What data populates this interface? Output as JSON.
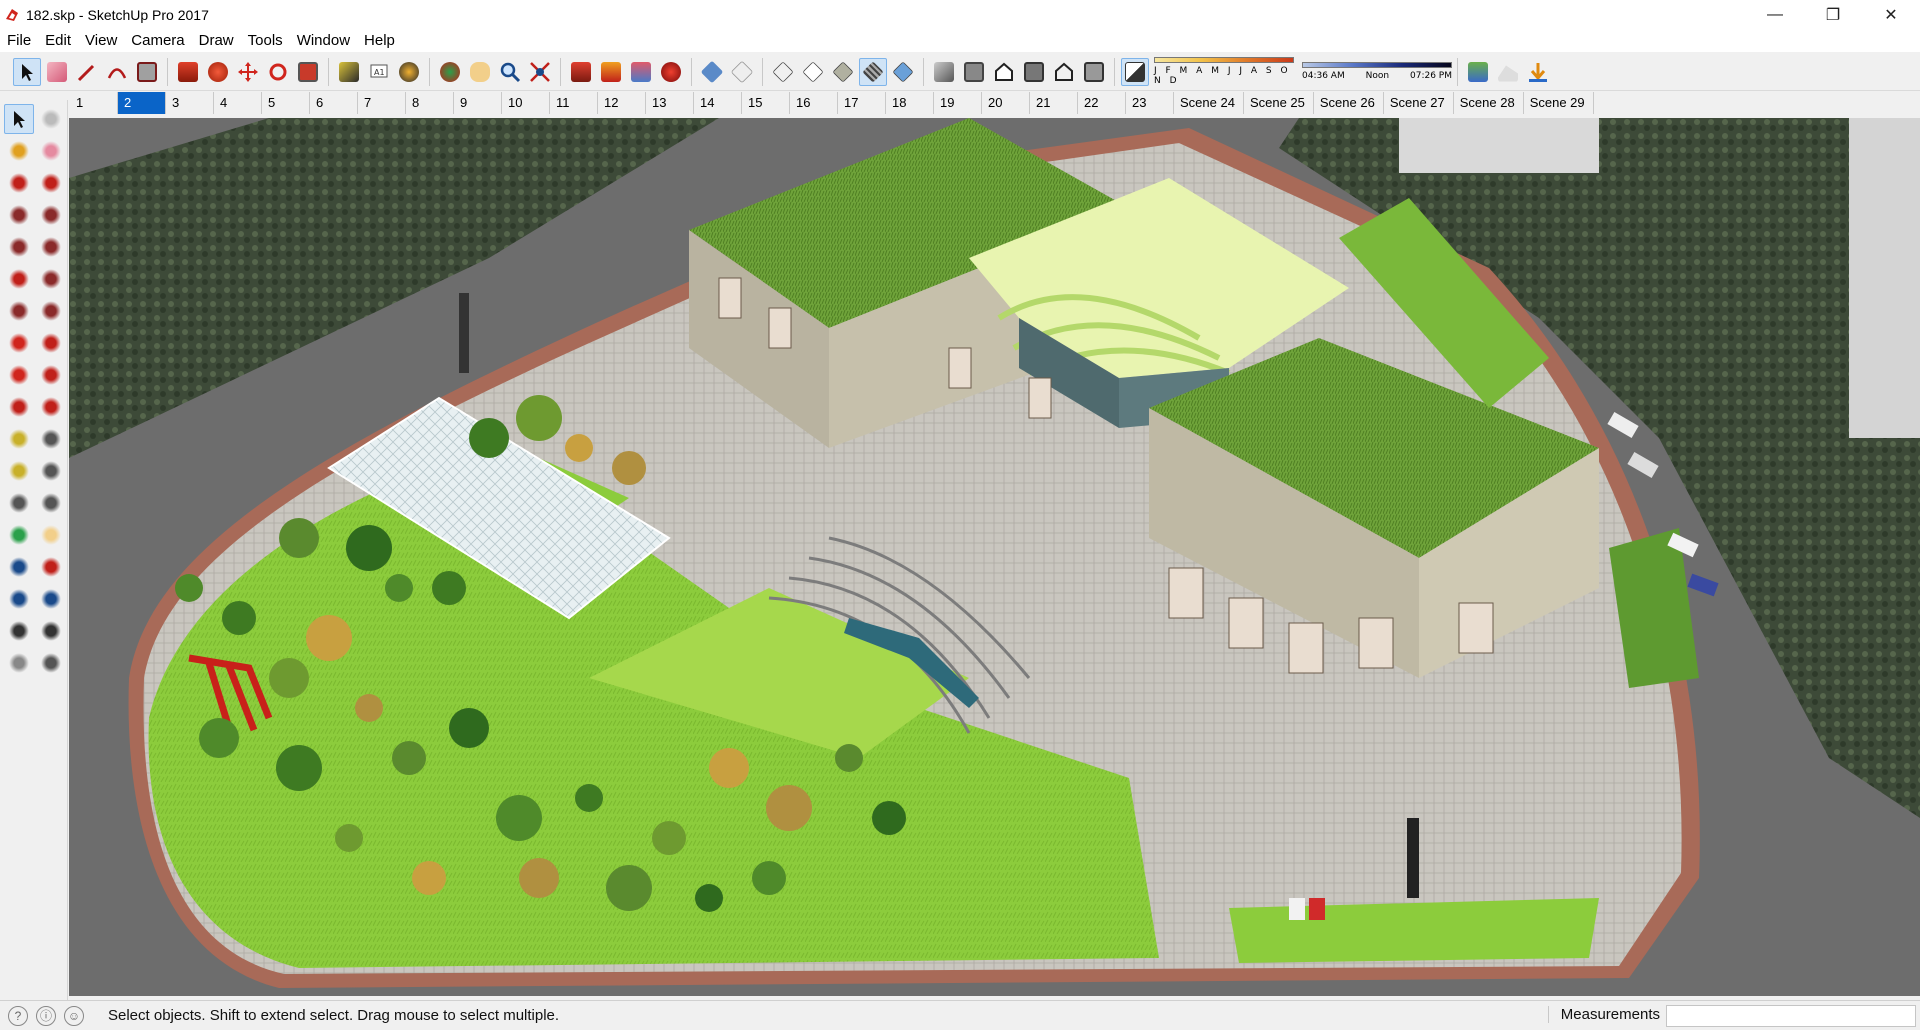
{
  "window": {
    "title": "182.skp - SketchUp Pro 2017",
    "minimize_glyph": "—",
    "restore_glyph": "❐",
    "close_glyph": "✕"
  },
  "menu": [
    "File",
    "Edit",
    "View",
    "Camera",
    "Draw",
    "Tools",
    "Window",
    "Help"
  ],
  "toolbar": {
    "shadow_months": "J F M A M J J A S O N D",
    "time_start": "04:36 AM",
    "time_noon": "Noon",
    "time_end": "07:26 PM"
  },
  "scenes": {
    "active_index": 1,
    "tabs": [
      "1",
      "2",
      "3",
      "4",
      "5",
      "6",
      "7",
      "8",
      "9",
      "10",
      "11",
      "12",
      "13",
      "14",
      "15",
      "16",
      "17",
      "18",
      "19",
      "20",
      "21",
      "22",
      "23",
      "Scene 24",
      "Scene 25",
      "Scene 26",
      "Scene 27",
      "Scene 28",
      "Scene 29"
    ]
  },
  "left_tools": [
    "select-icon",
    "component-icon",
    "paint-bucket-icon",
    "eraser-icon",
    "line-icon",
    "freehand-icon",
    "rectangle-icon",
    "rotated-rectangle-icon",
    "circle-icon",
    "polygon-icon",
    "arc-icon",
    "two-point-arc-icon",
    "pie-icon",
    "three-point-arc-icon",
    "move-icon",
    "push-pull-icon",
    "rotate-icon",
    "follow-me-icon",
    "scale-icon",
    "offset-icon",
    "tape-measure-icon",
    "dimension-icon",
    "protractor-icon",
    "text-icon",
    "axes-icon",
    "3d-text-icon",
    "orbit-icon",
    "pan-icon",
    "zoom-icon",
    "zoom-window-icon",
    "zoom-extents-icon",
    "previous-view-icon",
    "position-camera-icon",
    "look-around-icon",
    "walk-icon",
    "section-plane-icon"
  ],
  "status": {
    "message": "Select objects. Shift to extend select. Drag mouse to select multiple.",
    "measurements_label": "Measurements",
    "measurements_value": ""
  },
  "colors": {
    "accent": "#0a64c8",
    "grass": "#8cc63f",
    "road": "#6d6d6d",
    "roof": "#6fa33a"
  }
}
